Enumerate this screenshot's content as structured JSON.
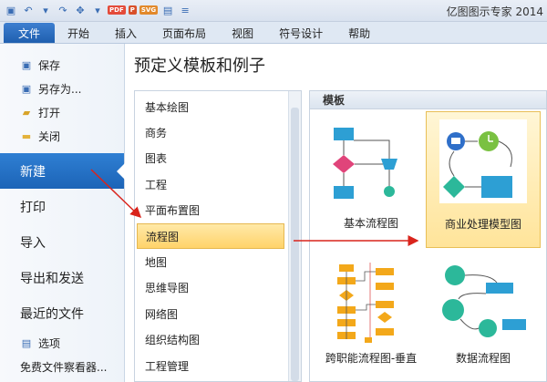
{
  "window": {
    "app_title": "亿图图示专家 2014"
  },
  "qat": {
    "pdf": "PDF",
    "ppt": "P",
    "svg": "SVG"
  },
  "ribbon": {
    "tabs": [
      {
        "label": "文件"
      },
      {
        "label": "开始"
      },
      {
        "label": "插入"
      },
      {
        "label": "页面布局"
      },
      {
        "label": "视图"
      },
      {
        "label": "符号设计"
      },
      {
        "label": "帮助"
      }
    ]
  },
  "nav": {
    "save": "保存",
    "save_as": "另存为...",
    "open": "打开",
    "close": "关闭",
    "new": "新建",
    "print": "打印",
    "import": "导入",
    "export_send": "导出和发送",
    "recent": "最近的文件",
    "options": "选项",
    "free_viewer": "免费文件察看器..."
  },
  "main": {
    "title": "预定义模板和例子"
  },
  "categories": [
    "基本绘图",
    "商务",
    "图表",
    "工程",
    "平面布置图",
    "流程图",
    "地图",
    "思维导图",
    "网络图",
    "组织结构图",
    "工程管理"
  ],
  "selected_category": "流程图",
  "templates": {
    "header": "模板",
    "items": [
      {
        "label": "基本流程图"
      },
      {
        "label": "商业处理模型图"
      },
      {
        "label": "跨职能流程图-垂直"
      },
      {
        "label": "数据流程图"
      }
    ],
    "selected": "商业处理模型图"
  },
  "colors": {
    "accent": "#1f64b8",
    "highlight": "#ffd36a",
    "annotation_arrow": "#d9241c"
  }
}
